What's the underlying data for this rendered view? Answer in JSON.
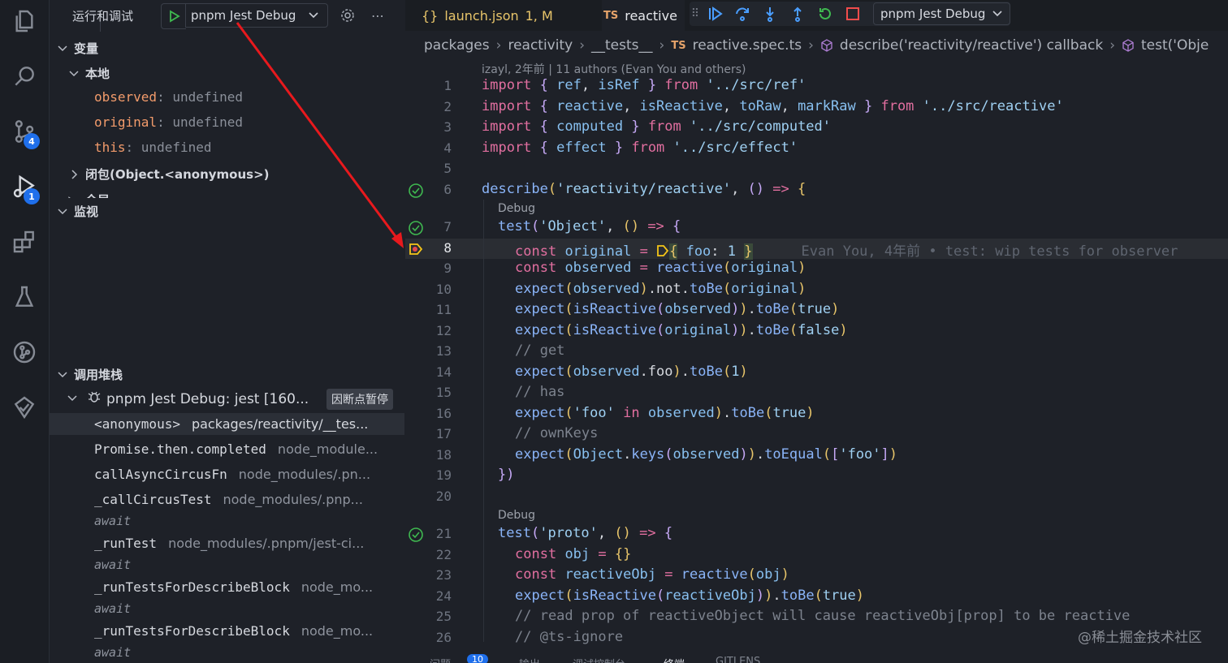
{
  "side": {
    "title": "运行和调试",
    "config": "pnpm Jest Debug",
    "sections": {
      "variables": "变量",
      "local": "本地",
      "closure": "闭包(Object.<anonymous>)",
      "global_partial": "全局",
      "watch": "监视",
      "callstack": "调用堆栈"
    },
    "locals": [
      {
        "name": "observed",
        "value": "undefined"
      },
      {
        "name": "original",
        "value": "undefined"
      },
      {
        "name": "this",
        "value": "undefined"
      }
    ],
    "session": {
      "name": "pnpm Jest Debug: jest [160...",
      "status": "因断点暂停"
    },
    "frames": [
      {
        "fn": "<anonymous>",
        "path": "packages/reactivity/__tes..."
      },
      {
        "fn": "Promise.then.completed",
        "path": "node_module..."
      },
      {
        "fn": "callAsyncCircusFn",
        "path": "node_modules/.pn..."
      },
      {
        "fn": "_callCircusTest",
        "path": "node_modules/.pnp..."
      },
      {
        "fn": "_runTest",
        "path": "node_modules/.pnpm/jest-ci..."
      },
      {
        "fn": "_runTestsForDescribeBlock",
        "path": "node_mo..."
      },
      {
        "fn": "_runTestsForDescribeBlock",
        "path": "node_mo..."
      }
    ],
    "await_label": "await"
  },
  "activity": {
    "source_control_badge": "4",
    "debug_badge": "1"
  },
  "tabs": {
    "launch": {
      "icon": "{}",
      "name": "launch.json",
      "status": "1, M"
    },
    "reactive": {
      "icon": "TS",
      "name": "reactive"
    }
  },
  "debug_toolbar": {
    "config": "pnpm Jest Debug"
  },
  "breadcrumb": {
    "items": [
      "packages",
      "reactivity",
      "__tests__"
    ],
    "ts_icon": "TS",
    "file": "reactive.spec.ts",
    "describe": "describe('reactivity/reactive') callback",
    "test": "test('Obje"
  },
  "blame_header": "izayl, 2年前 | 11 authors (Evan You and others)",
  "code_lens": "Debug",
  "inline_blame": "Evan You, 4年前 • test: wip tests for observer",
  "line_numbers": [
    "1",
    "2",
    "3",
    "4",
    "5",
    "6",
    "7",
    "8",
    "9",
    "10",
    "11",
    "12",
    "13",
    "14",
    "15",
    "16",
    "17",
    "18",
    "19",
    "20",
    "21",
    "22",
    "23",
    "24",
    "25",
    "26"
  ],
  "bottom_tabs": [
    "问题",
    "输出",
    "调试控制台",
    "终端",
    "GITLENS"
  ],
  "bottom_badge": "10",
  "watermark": "@稀土掘金技术社区",
  "colors": {
    "keyword": "#e26fa0",
    "string": "#9fd0f2",
    "function": "#8ab4f8",
    "variable_name": "#f29b6b",
    "breakpoint": "#f5c518",
    "pass": "#3fb950",
    "arrow": "#e8191d",
    "badge": "#1f6feb"
  }
}
